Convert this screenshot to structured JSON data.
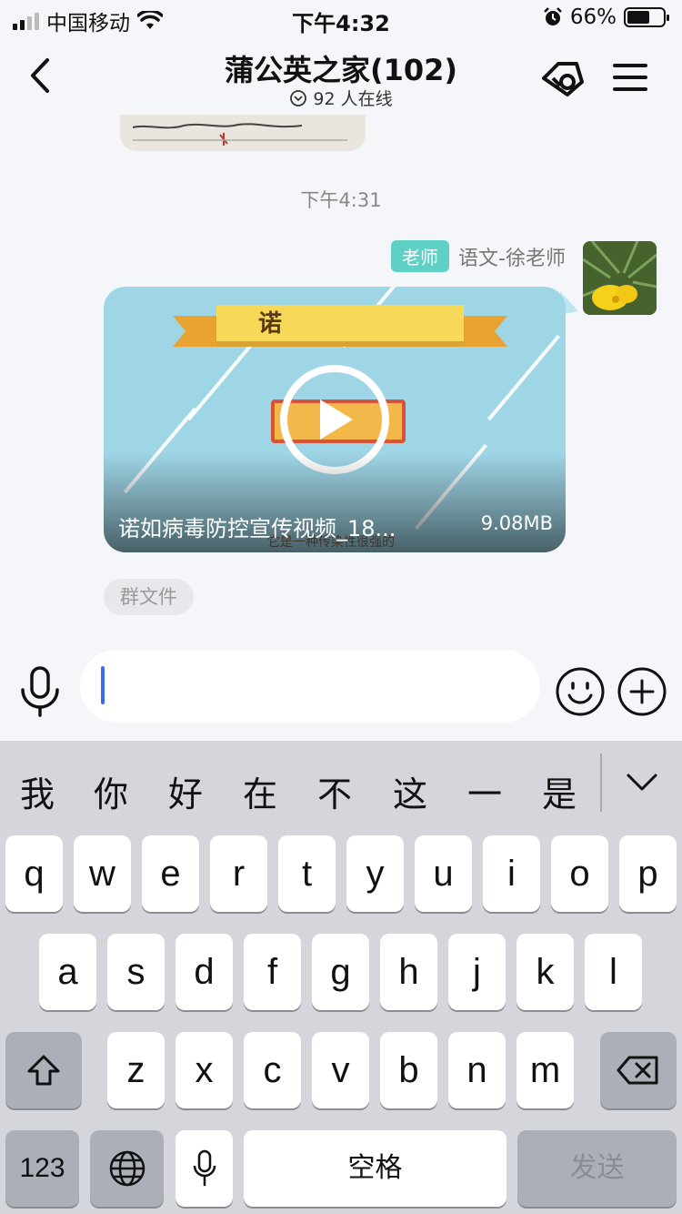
{
  "status_bar": {
    "carrier": "中国移动",
    "time": "下午4:32",
    "battery": "66%"
  },
  "nav": {
    "title": "蒲公英之家(102)",
    "online": "92 人在线"
  },
  "chat": {
    "timestamp": "下午4:31",
    "message": {
      "role_badge": "老师",
      "sender": "语文-徐老师",
      "video": {
        "banner_text": "诺",
        "title": "诺如病毒防控宣传视频_18...",
        "size": "9.08MB",
        "frame_subtitle": "它是一种传染性很强的"
      },
      "source_label": "群文件"
    }
  },
  "input": {
    "value": ""
  },
  "keyboard": {
    "candidates": [
      "我",
      "你",
      "好",
      "在",
      "不",
      "这",
      "一",
      "是"
    ],
    "row1": [
      "q",
      "w",
      "e",
      "r",
      "t",
      "y",
      "u",
      "i",
      "o",
      "p"
    ],
    "row2": [
      "a",
      "s",
      "d",
      "f",
      "g",
      "h",
      "j",
      "k",
      "l"
    ],
    "row3": [
      "z",
      "x",
      "c",
      "v",
      "b",
      "n",
      "m"
    ],
    "numbers_key": "123",
    "space_key": "空格",
    "send_key": "发送"
  },
  "colors": {
    "badge": "#5ed0c5",
    "caret": "#3c6cf0",
    "keyboard_bg": "#d4d6dc"
  }
}
